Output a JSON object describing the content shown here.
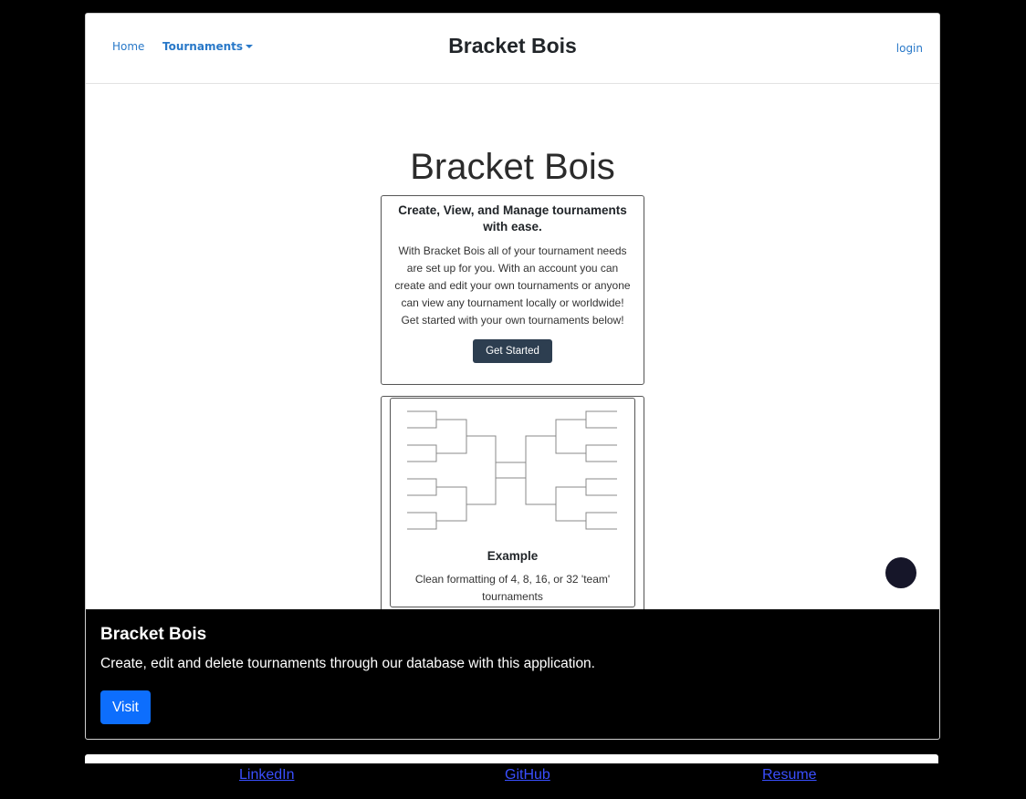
{
  "navbar": {
    "home": "Home",
    "tournaments": "Tournaments",
    "brand": "Bracket Bois",
    "login": "login"
  },
  "hero": {
    "title": "Bracket Bois"
  },
  "intro_card": {
    "heading": "Create, View, and Manage tournaments with ease.",
    "body": "With Bracket Bois all of your tournament needs are set up for you. With an account you can create and edit your own tournaments or anyone can view any tournament locally or worldwide! Get started with your own tournaments below!",
    "button": "Get Started"
  },
  "example_card": {
    "title": "Example",
    "description": "Clean formatting of 4, 8, 16, or 32 'team' tournaments"
  },
  "overlay": {
    "title": "Bracket Bois",
    "description": "Create, edit and delete tournaments through our database with this application.",
    "button": "Visit"
  },
  "footer": {
    "linkedin": "LinkedIn",
    "github": "GitHub",
    "resume": "Resume"
  },
  "colors": {
    "link": "#2878c8",
    "primary_button": "#0d6efd",
    "dark_button": "#2d3e50",
    "chat_bubble": "#161629"
  }
}
